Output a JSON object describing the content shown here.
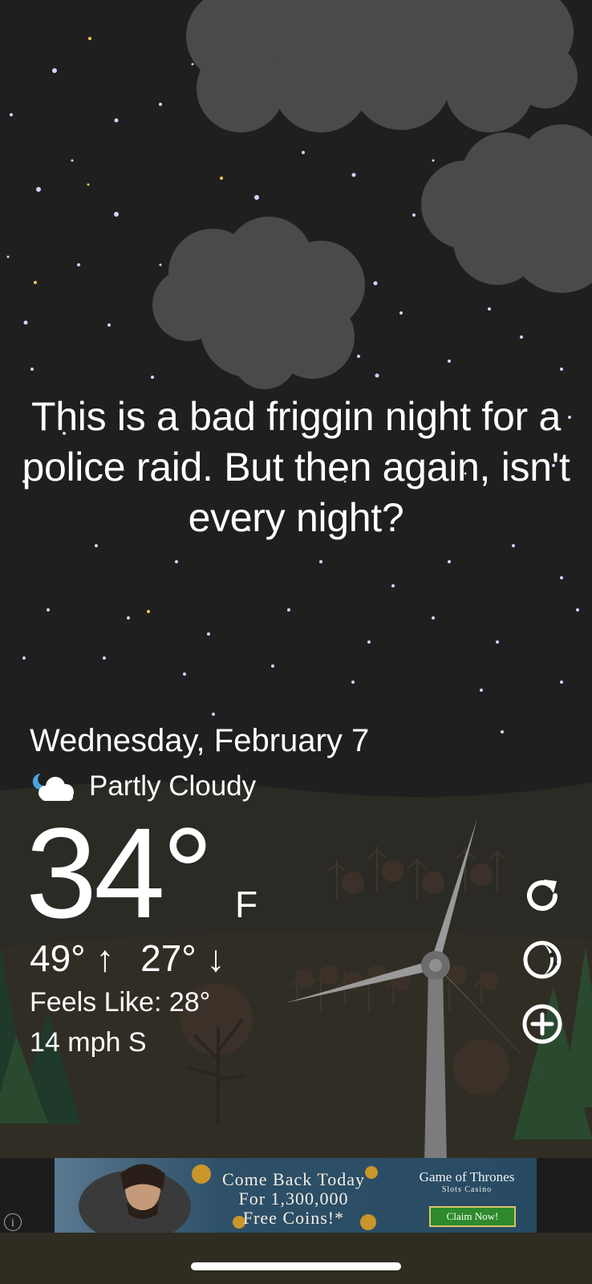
{
  "quote": {
    "text": "This is a bad friggin night for a police raid. But then again, isn't every night?"
  },
  "weather": {
    "date": "Wednesday, February 7",
    "condition": "Partly Cloudy",
    "condition_icon": "partly-cloudy-night-icon",
    "temperature": "34°",
    "unit": "F",
    "high": "49° ↑",
    "low": "27° ↓",
    "feels_like": "Feels Like: 28°",
    "wind": "14 mph S"
  },
  "actions": {
    "refresh_icon": "refresh-icon",
    "theme_icon": "moon-icon",
    "add_icon": "add-location-icon"
  },
  "ad": {
    "line1": "Come Back Today",
    "line2": "For 1,300,000",
    "line3": "Free Coins!*",
    "brand": "Game of Thrones",
    "brand_sub": "Slots Casino",
    "cta": "Claim Now!",
    "info_icon": "info-icon"
  },
  "colors": {
    "sky": "#1f1f1f",
    "hills": "#2a2824",
    "ground": "#2f2c22",
    "text": "#ffffff"
  }
}
